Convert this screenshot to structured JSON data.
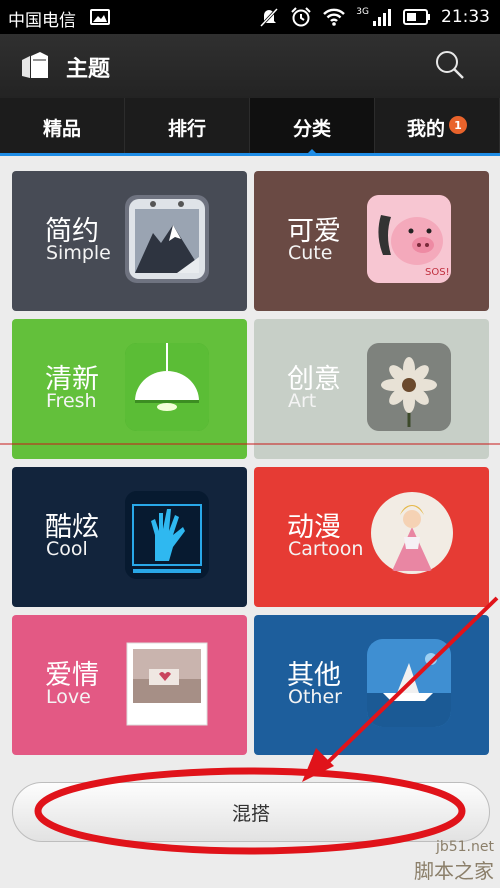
{
  "status_bar": {
    "carrier": "中国电信",
    "network": "3G",
    "time": "21:33"
  },
  "app_bar": {
    "title": "主题",
    "icons": [
      "theme-book-icon",
      "search-icon"
    ]
  },
  "tabs": [
    {
      "label": "精品",
      "active": false
    },
    {
      "label": "排行",
      "active": false
    },
    {
      "label": "分类",
      "active": true
    },
    {
      "label": "我的",
      "active": false,
      "badge": "1"
    }
  ],
  "categories": [
    {
      "zh": "简约",
      "en": "Simple",
      "bg": "#474b55",
      "icon": "mountain-picture-icon"
    },
    {
      "zh": "可爱",
      "en": "Cute",
      "bg": "#6a4a44",
      "icon": "pig-phone-icon"
    },
    {
      "zh": "清新",
      "en": "Fresh",
      "bg": "#63c03b",
      "icon": "lamp-icon"
    },
    {
      "zh": "创意",
      "en": "Art",
      "bg": "#c7cfc7",
      "icon": "flower-icon"
    },
    {
      "zh": "酷炫",
      "en": "Cool",
      "bg": "#12243c",
      "icon": "hand-scan-icon"
    },
    {
      "zh": "动漫",
      "en": "Cartoon",
      "bg": "#e63b34",
      "icon": "cartoon-girl-icon"
    },
    {
      "zh": "爱情",
      "en": "Love",
      "bg": "#e35984",
      "icon": "love-photo-icon"
    },
    {
      "zh": "其他",
      "en": "Other",
      "bg": "#1d5e9c",
      "icon": "paper-boat-icon"
    }
  ],
  "mix_button": {
    "label": "混搭"
  },
  "watermark": {
    "line1": "jb51.net",
    "line2": "脚本之家"
  },
  "colors": {
    "accent": "#1f8de6",
    "annotation_red": "#e0131a",
    "badge": "#e9632b"
  }
}
